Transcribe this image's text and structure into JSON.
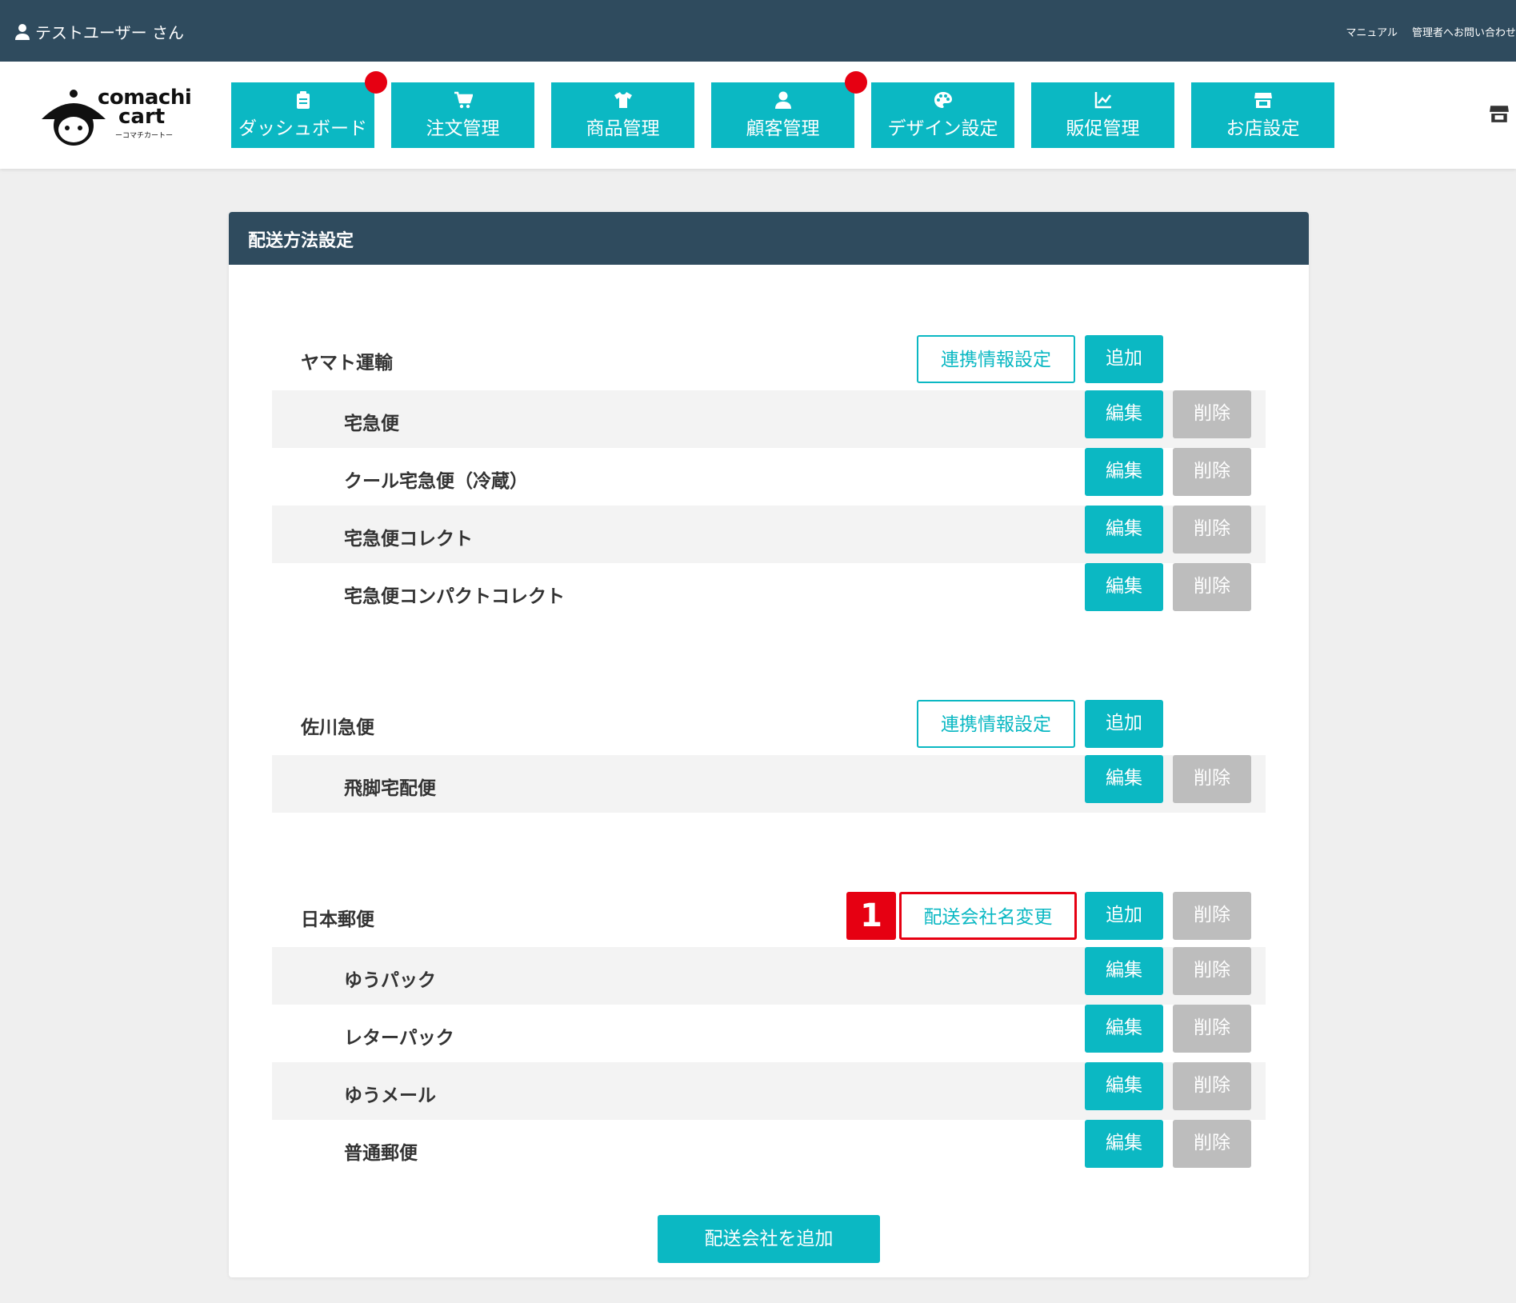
{
  "topbar": {
    "user_label": "テストユーザー さん",
    "links": [
      "マニュアル",
      "管理者へお問い合わせ"
    ]
  },
  "brand": {
    "line1": "comachi",
    "line2": "cart",
    "tagline": "ーコマチカートー"
  },
  "nav": [
    {
      "label": "ダッシュボード",
      "icon": "clipboard-icon",
      "badge": true
    },
    {
      "label": "注文管理",
      "icon": "cart-icon",
      "badge": false
    },
    {
      "label": "商品管理",
      "icon": "tshirt-icon",
      "badge": false
    },
    {
      "label": "顧客管理",
      "icon": "user-icon",
      "badge": true
    },
    {
      "label": "デザイン設定",
      "icon": "palette-icon",
      "badge": false
    },
    {
      "label": "販促管理",
      "icon": "chart-line-icon",
      "badge": false
    },
    {
      "label": "お店設定",
      "icon": "store-icon",
      "badge": false
    }
  ],
  "panel": {
    "title": "配送方法設定"
  },
  "companies": [
    {
      "name": "ヤマト運輸",
      "link_label": "連携情報設定",
      "add_label": "追加",
      "methods": [
        "宅急便",
        "クール宅急便（冷蔵）",
        "宅急便コレクト",
        "宅急便コンパクトコレクト"
      ]
    },
    {
      "name": "佐川急便",
      "link_label": "連携情報設定",
      "add_label": "追加",
      "methods": [
        "飛脚宅配便"
      ]
    },
    {
      "name": "日本郵便",
      "rename_label": "配送会社名変更",
      "marker": "1",
      "add_label": "追加",
      "delete_label": "削除",
      "methods": [
        "ゆうパック",
        "レターパック",
        "ゆうメール",
        "普通郵便"
      ]
    }
  ],
  "buttons": {
    "edit": "編集",
    "delete": "削除",
    "add_company": "配送会社を追加"
  },
  "colors": {
    "teal": "#0bb8c3",
    "navy": "#2f4b5e",
    "red": "#e60012",
    "gray": "#bdbdbd"
  }
}
